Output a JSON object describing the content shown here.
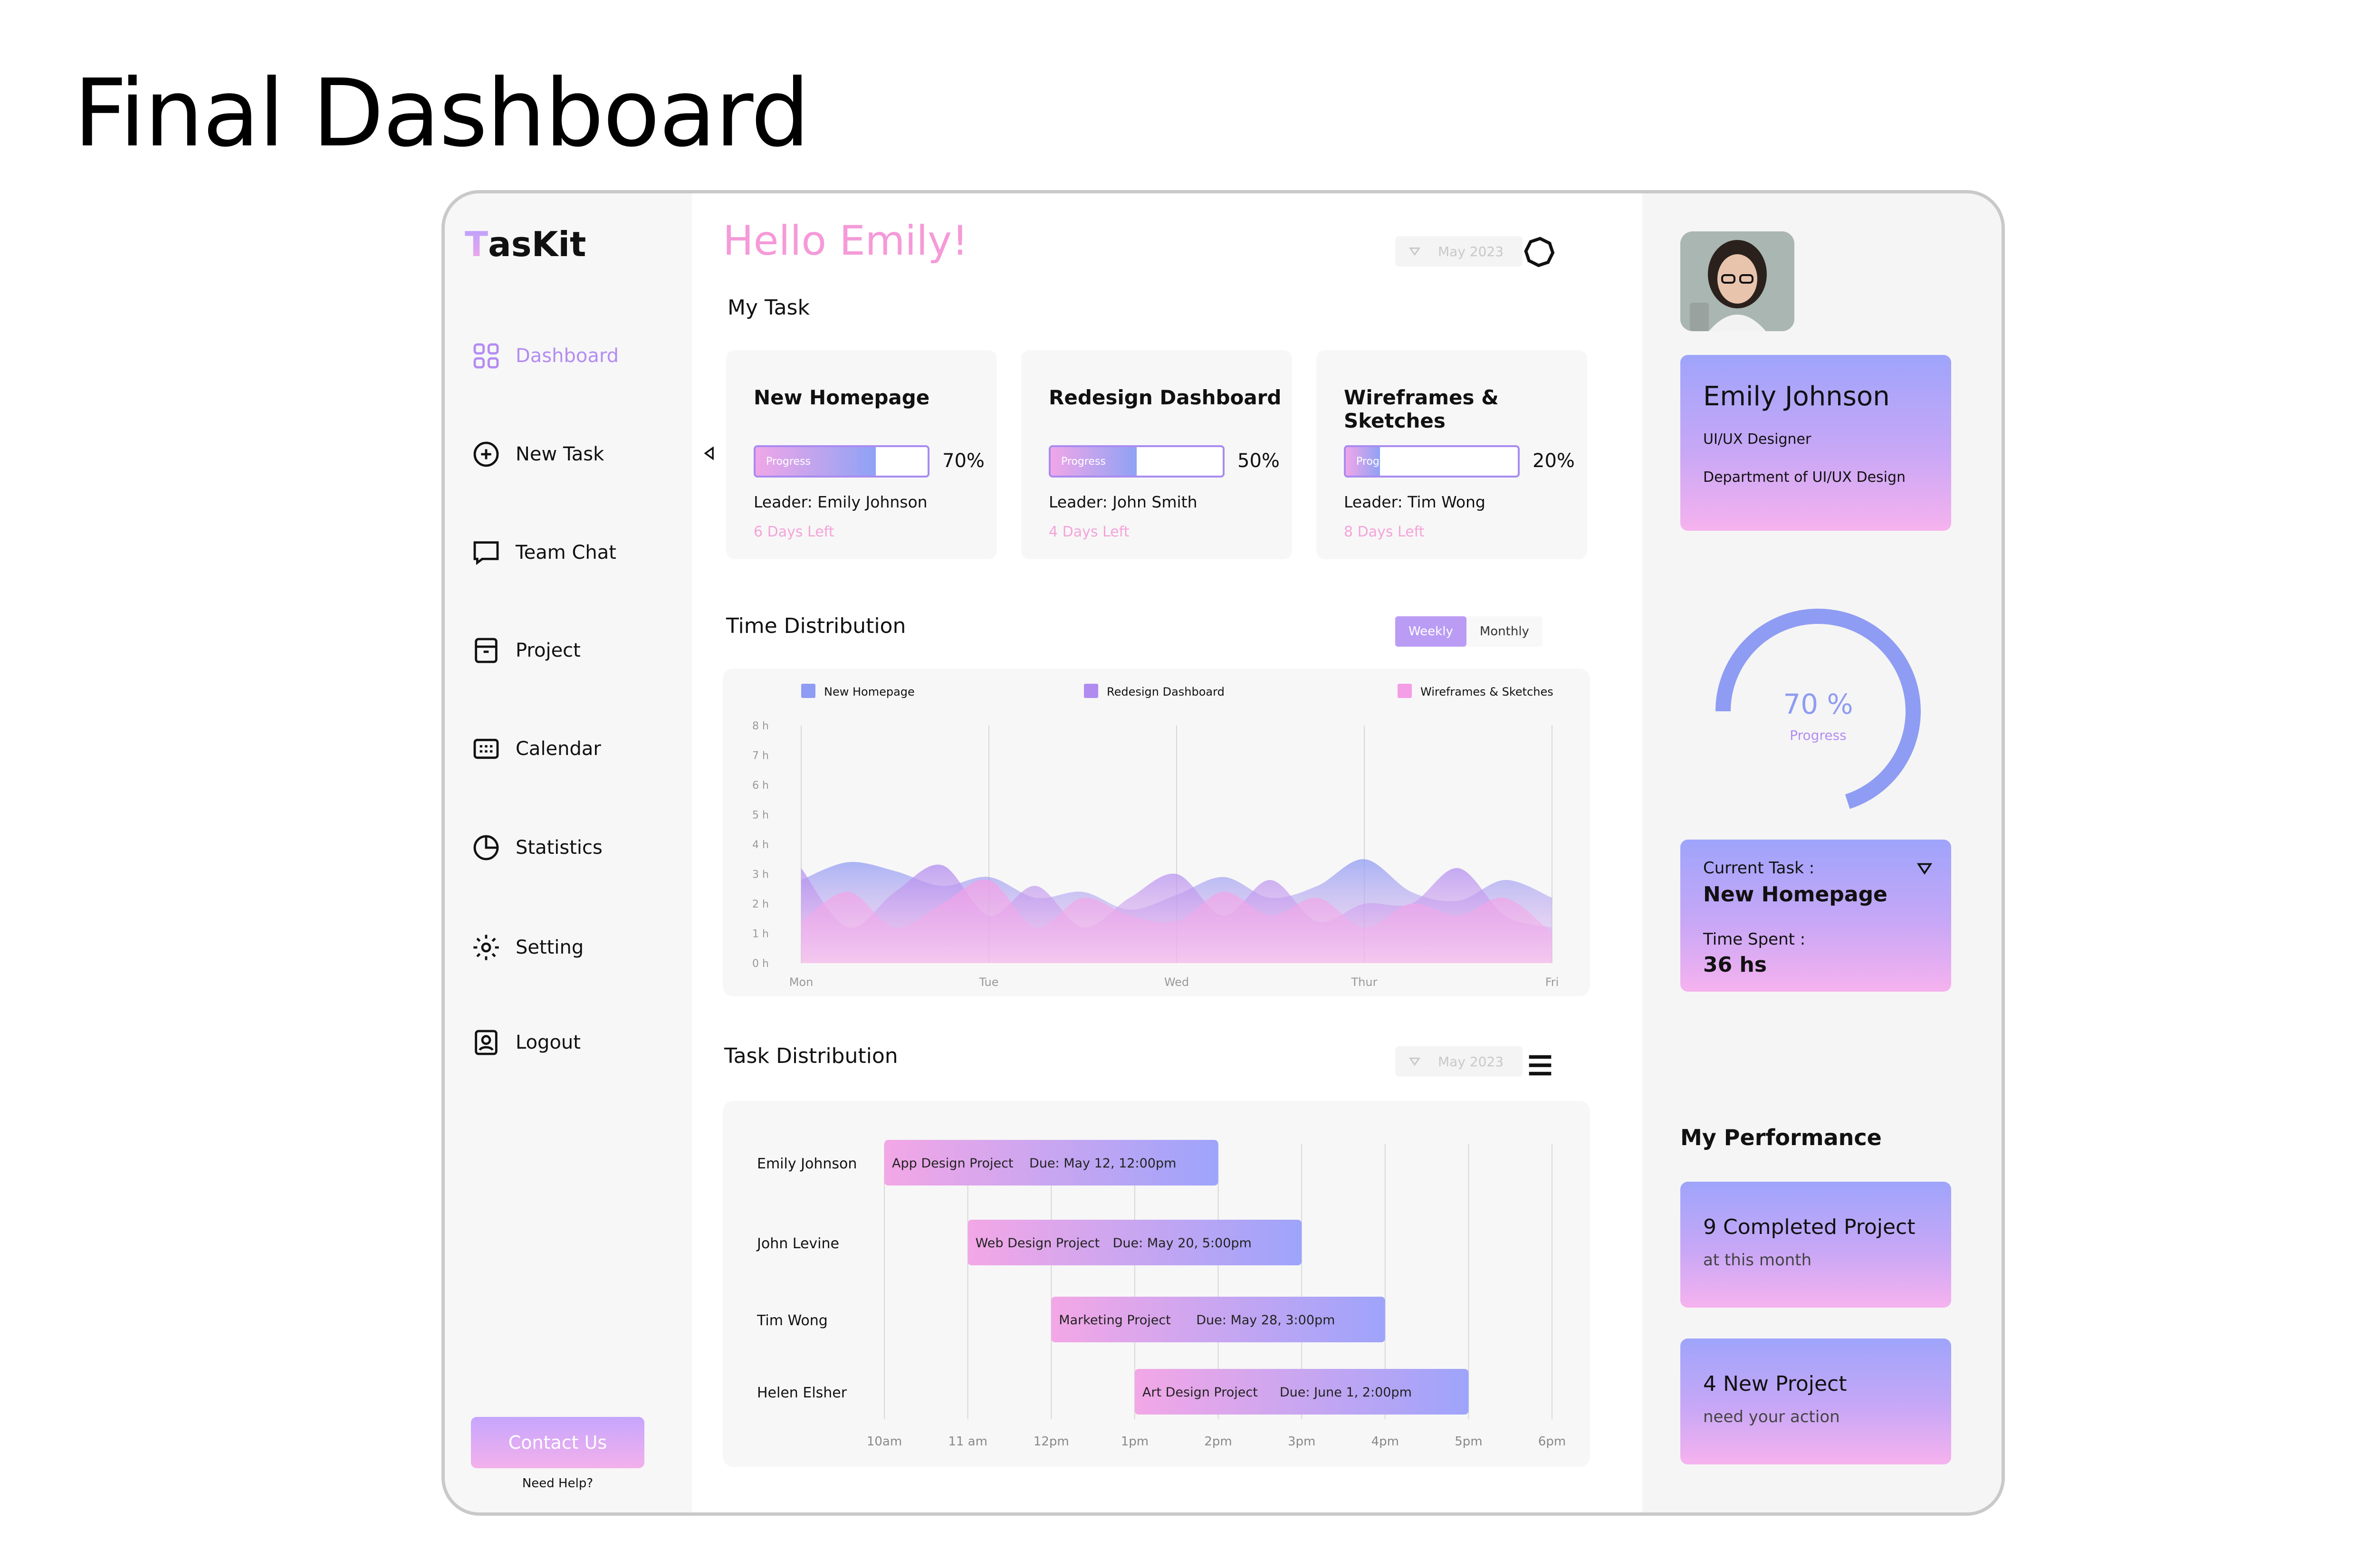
{
  "page_heading": "Final Dashboard",
  "app": {
    "logo_t": "T",
    "logo_rest": "asKit"
  },
  "sidebar": {
    "items": [
      {
        "label": "Dashboard",
        "icon": "grid-icon",
        "active": true
      },
      {
        "label": "New Task",
        "icon": "plus-circle-icon"
      },
      {
        "label": "Team Chat",
        "icon": "chat-icon"
      },
      {
        "label": "Project",
        "icon": "archive-icon"
      },
      {
        "label": "Calendar",
        "icon": "calendar-icon"
      },
      {
        "label": "Statistics",
        "icon": "pie-chart-icon"
      },
      {
        "label": "Setting",
        "icon": "gear-icon"
      },
      {
        "label": "Logout",
        "icon": "logout-icon"
      }
    ],
    "contact_button": "Contact Us",
    "need_help": "Need Help?"
  },
  "header": {
    "greeting": "Hello Emily!",
    "date": "May 2023"
  },
  "my_task": {
    "title": "My Task",
    "cards": [
      {
        "title": "New Homepage",
        "progress_label": "Progress",
        "progress": 70,
        "percent_text": "70%",
        "leader": "Leader: Emily Johnson",
        "days_left": "6 Days Left"
      },
      {
        "title": "Redesign Dashboard",
        "progress_label": "Progress",
        "progress": 50,
        "percent_text": "50%",
        "leader": "Leader: John Smith",
        "days_left": "4 Days Left"
      },
      {
        "title": "Wireframes & Sketches",
        "progress_label": "Progress",
        "progress": 20,
        "percent_text": "20%",
        "leader": "Leader: Tim Wong",
        "days_left": "8 Days Left"
      }
    ]
  },
  "time_distribution": {
    "title": "Time Distribution",
    "toggle": {
      "weekly": "Weekly",
      "monthly": "Monthly",
      "selected": "Weekly"
    }
  },
  "chart_data": {
    "type": "area",
    "categories": [
      "Mon",
      "Tue",
      "Wed",
      "Thur",
      "Fri"
    ],
    "yticks": [
      "8 h",
      "7 h",
      "6 h",
      "5 h",
      "4 h",
      "3 h",
      "2 h",
      "1 h",
      "0 h"
    ],
    "ylim": [
      0,
      8
    ],
    "x": [
      0,
      0.25,
      0.5,
      0.75,
      1,
      1.25,
      1.5,
      1.75,
      2,
      2.25,
      2.5,
      2.75,
      3,
      3.25,
      3.5,
      3.75,
      4
    ],
    "series": [
      {
        "name": "New Homepage",
        "color": "#8f9cf3",
        "values": [
          2.8,
          3.4,
          3.1,
          2.6,
          2.9,
          2.2,
          2.4,
          1.8,
          2.3,
          2.9,
          2.2,
          2.6,
          3.5,
          2.4,
          2.1,
          2.8,
          2.2
        ]
      },
      {
        "name": "Redesign Dashboard",
        "color": "#b08cf0",
        "values": [
          3.2,
          1.2,
          2.4,
          3.3,
          1.6,
          2.6,
          1.2,
          2.2,
          3.0,
          1.6,
          2.8,
          1.4,
          2.0,
          2.0,
          3.2,
          1.6,
          1.2
        ]
      },
      {
        "name": "Wireframes & Sketches",
        "color": "#f39ee6",
        "values": [
          1.4,
          2.4,
          1.2,
          2.0,
          2.8,
          1.2,
          2.2,
          1.6,
          1.4,
          2.4,
          1.6,
          2.2,
          1.2,
          2.0,
          1.6,
          2.2,
          1.0
        ]
      }
    ]
  },
  "task_distribution": {
    "title": "Task Distribution",
    "date": "May 2023",
    "hours": [
      "10am",
      "11 am",
      "12pm",
      "1pm",
      "2pm",
      "3pm",
      "4pm",
      "5pm",
      "6pm"
    ],
    "rows": [
      {
        "person": "Emily Johnson",
        "project": "App Design Project",
        "due": "Due: May 12, 12:00pm",
        "start_hour": 10,
        "end_hour": 14
      },
      {
        "person": "John Levine",
        "project": "Web Design Project",
        "due": "Due: May 20, 5:00pm",
        "start_hour": 11,
        "end_hour": 15
      },
      {
        "person": "Tim Wong",
        "project": "Marketing Project",
        "due": "Due: May 28, 3:00pm",
        "start_hour": 12,
        "end_hour": 16
      },
      {
        "person": "Helen Elsher",
        "project": "Art Design Project",
        "due": "Due: June 1, 2:00pm",
        "start_hour": 13,
        "end_hour": 17
      }
    ]
  },
  "profile": {
    "name": "Emily Johnson",
    "role": "UI/UX Designer",
    "department": "Department of UI/UX Design"
  },
  "progress": {
    "value": 70,
    "text": "70 %",
    "label": "Progress"
  },
  "current_task": {
    "label": "Current Task :",
    "name": "New Homepage",
    "time_label": "Time Spent :",
    "time_value": "36 hs"
  },
  "performance": {
    "title": "My Performance",
    "cards": [
      {
        "big": "9 Completed Project",
        "small": "at this month"
      },
      {
        "big": "4 New Project",
        "small": "need your action"
      }
    ]
  },
  "colors": {
    "accent_pink": "#f59ad8",
    "accent_purple": "#b38cf2",
    "accent_blue": "#8f9cf3"
  }
}
